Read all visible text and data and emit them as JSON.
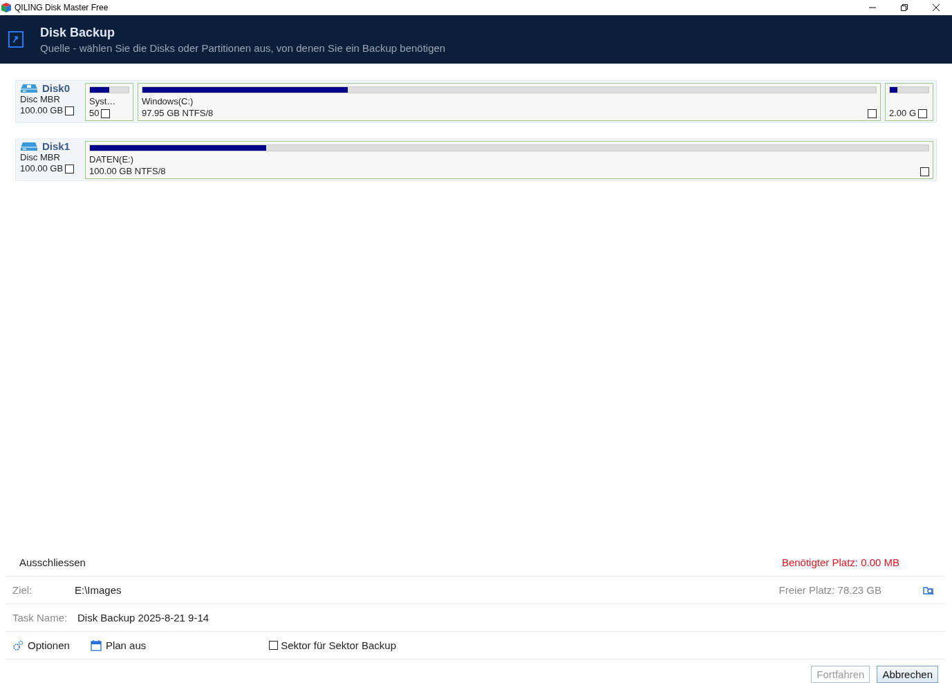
{
  "window": {
    "title": "QILING Disk Master Free"
  },
  "header": {
    "title": "Disk Backup",
    "subtitle": "Quelle - wählen Sie die Disks oder Partitionen aus, von denen Sie ein Backup benötigen"
  },
  "disks": [
    {
      "name": "Disk0",
      "type": "Disc MBR",
      "size": "100.00 GB",
      "checked": false,
      "partitions": [
        {
          "kind": "small",
          "label": "Syst…",
          "info": "50",
          "level": 0.5,
          "checked": false
        },
        {
          "kind": "large",
          "label": "Windows(C:)",
          "info": "97.95 GB NTFS/8",
          "level": 0.28,
          "checked": false
        },
        {
          "kind": "small",
          "info": "2.00 G",
          "level": 0.2,
          "checked": false
        }
      ]
    },
    {
      "name": "Disk1",
      "type": "Disc MBR",
      "size": "100.00 GB",
      "checked": false,
      "partitions": [
        {
          "kind": "large",
          "label": "DATEN(E:)",
          "info": "100.00 GB NTFS/8",
          "level": 0.21,
          "checked": false
        }
      ]
    }
  ],
  "exclude": {
    "label": "Ausschliessen",
    "required_space": "Benötigter Platz: 0.00 MB"
  },
  "target": {
    "label": "Ziel:",
    "value": "E:\\Images",
    "free_space": "Freier Platz: 78.23 GB"
  },
  "task": {
    "label": "Task Name:",
    "value": "Disk Backup 2025-8-21 9-14"
  },
  "options": {
    "options_label": "Optionen",
    "schedule_label": "Plan aus",
    "sector_label": "Sektor für Sektor Backup",
    "sector_checked": false
  },
  "buttons": [
    {
      "label": "Fortfahren",
      "disabled": true
    },
    {
      "label": "Abbrechen",
      "disabled": false
    }
  ]
}
